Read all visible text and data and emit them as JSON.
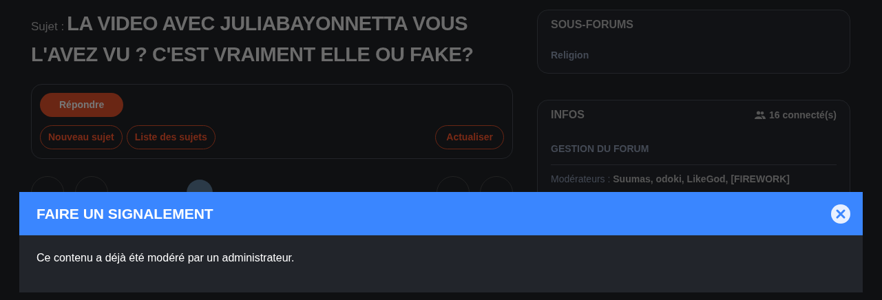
{
  "topic": {
    "label": "Sujet :",
    "title": "LA VIDEO AVEC JULIABAYONNETTA VOUS L'AVEZ VU ? C'EST VRAIMENT ELLE OU FAKE?"
  },
  "actions": {
    "primary": "Répondre",
    "secondary": [
      "Nouveau sujet",
      "Liste des sujets"
    ],
    "refresh": "Actualiser"
  },
  "subforums": {
    "title": "SOUS-FORUMS",
    "items": [
      "Religion"
    ]
  },
  "infos": {
    "title": "INFOS",
    "connected": "16 connecté(s)",
    "section": "GESTION DU FORUM",
    "moderators_label": "Modérateurs :",
    "moderators": "Suumas, odoki, LikeGod, [FIREWORK]"
  },
  "modal": {
    "title": "FAIRE UN SIGNALEMENT",
    "message": "Ce contenu a déjà été modéré par un administrateur."
  }
}
